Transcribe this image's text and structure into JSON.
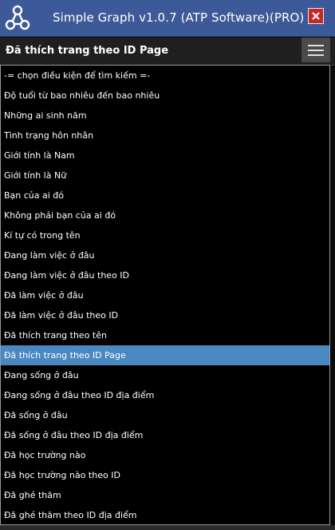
{
  "window": {
    "title": "Simple Graph v1.0.7 (ATP Software)(PRO)",
    "logo_icon": "graph-nodes-icon",
    "close_icon": "close-icon",
    "colors": {
      "titlebar": "#3d5a98",
      "close": "#c62828",
      "selected_option": "#4a88c2"
    }
  },
  "combo": {
    "selected_label": "Đã thích trang theo ID Page",
    "menu_icon": "hamburger-menu-icon"
  },
  "options": [
    "-= chọn điều kiện để tìm kiếm =-",
    "Độ tuổi từ bao nhiêu đến bao nhiêu",
    "Những ai sinh năm",
    "Tình trạng hôn nhân",
    "Giới tính là Nam",
    "Giới tính là Nữ",
    "Bạn của ai đó",
    "Không phải bạn của ai đó",
    "Kí tự có trong tên",
    "Đang làm việc ở đâu",
    "Đang làm việc ở đâu theo ID",
    "Đã làm việc ở đâu",
    "Đã làm việc ở đâu theo ID",
    "Đã thích trang theo tên",
    "Đã thích trang theo ID Page",
    "Đang sống ở đâu",
    "Đang sống ở đâu theo ID địa điểm",
    "Đã sống ở đâu",
    "Đã sống ở đâu theo ID địa điểm",
    "Đã học trường nào",
    "Đã học trường nào theo ID",
    "Đã ghé thăm",
    "Đã ghé thăm theo ID địa điểm"
  ],
  "selected_index": 14
}
